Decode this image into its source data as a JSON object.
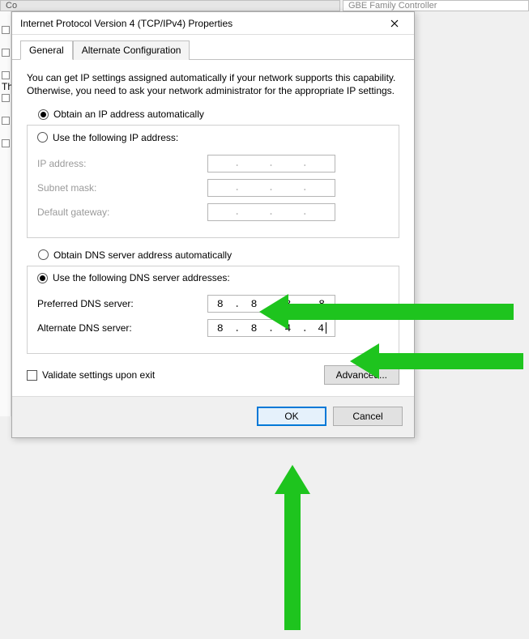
{
  "background": {
    "top_frag": "Co",
    "top_frag2": "GBE Family Controller",
    "left_label": "Th"
  },
  "dialog": {
    "title": "Internet Protocol Version 4 (TCP/IPv4) Properties",
    "tabs": {
      "general": "General",
      "alt": "Alternate Configuration"
    },
    "description": "You can get IP settings assigned automatically if your network supports this capability. Otherwise, you need to ask your network administrator for the appropriate IP settings.",
    "ip": {
      "auto_label": "Obtain an IP address automatically",
      "manual_label": "Use the following IP address:",
      "ip_label": "IP address:",
      "subnet_label": "Subnet mask:",
      "gateway_label": "Default gateway:"
    },
    "dns": {
      "auto_label": "Obtain DNS server address automatically",
      "manual_label": "Use the following DNS server addresses:",
      "preferred_label": "Preferred DNS server:",
      "alternate_label": "Alternate DNS server:",
      "preferred": {
        "o1": "8",
        "o2": "8",
        "o3": "8",
        "o4": "8"
      },
      "alternate": {
        "o1": "8",
        "o2": "8",
        "o3": "4",
        "o4": "4"
      }
    },
    "validate_label": "Validate settings upon exit",
    "advanced_label": "Advanced...",
    "ok_label": "OK",
    "cancel_label": "Cancel"
  }
}
